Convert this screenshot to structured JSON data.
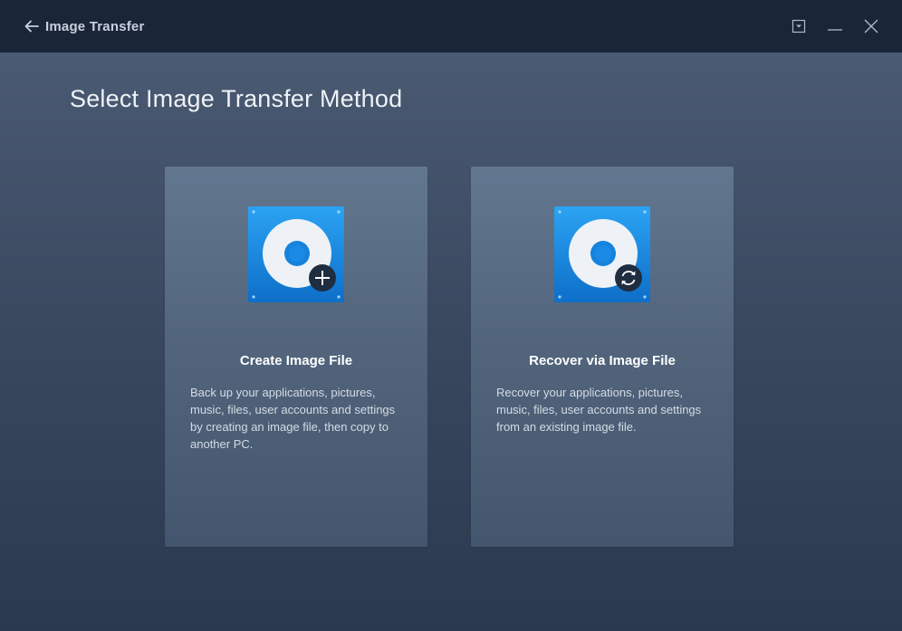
{
  "header": {
    "title": "Image Transfer",
    "icons": {
      "back": "back-arrow-icon",
      "menu": "dropdown-menu-icon",
      "minimize": "minimize-icon",
      "close": "close-icon"
    }
  },
  "main": {
    "title": "Select Image Transfer Method",
    "options": [
      {
        "title": "Create Image File",
        "description": "Back up your applications, pictures, music, files, user accounts and settings by creating an image file, then copy to another PC.",
        "icon": "disk-add-icon",
        "badge": "plus-icon"
      },
      {
        "title": "Recover via Image File",
        "description": "Recover your applications, pictures, music, files, user accounts and settings from an existing image file.",
        "icon": "disk-recover-icon",
        "badge": "refresh-icon"
      }
    ]
  },
  "colors": {
    "titlebar": "#1a2538",
    "background": "#3a4960",
    "card": "#52657c",
    "icon_accent": "#1e8fe6"
  }
}
